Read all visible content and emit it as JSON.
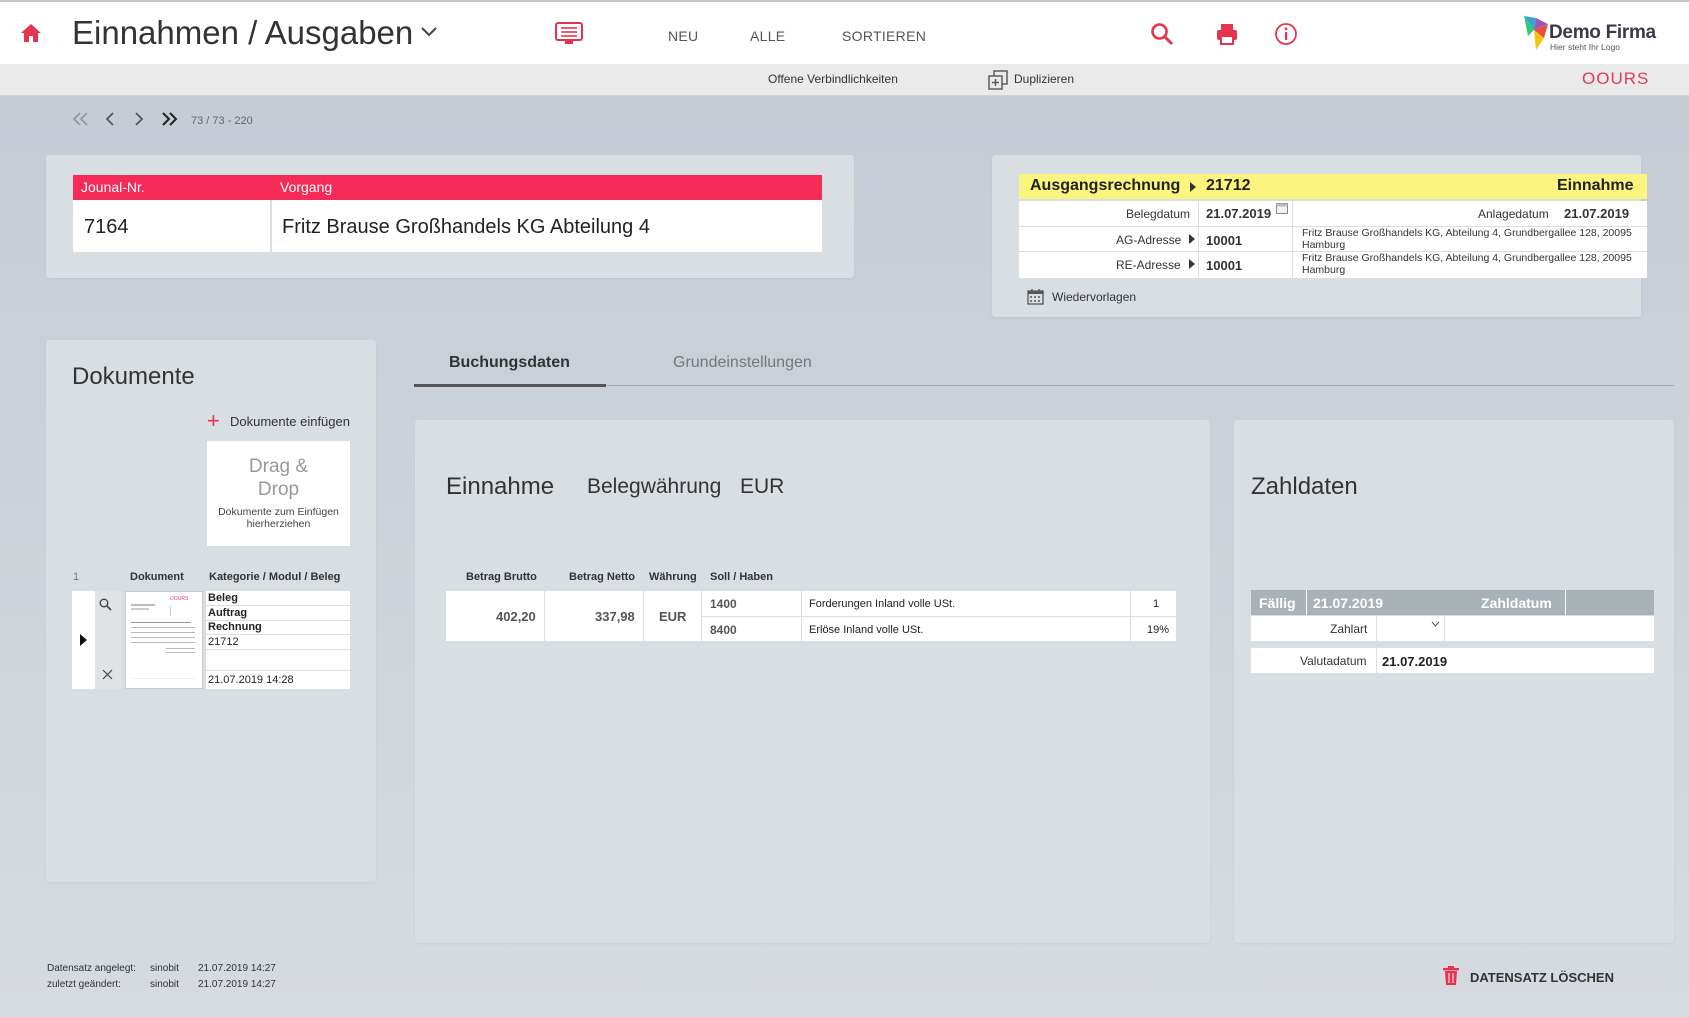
{
  "header": {
    "title": "Einnahmen / Ausgaben",
    "nav": [
      "NEU",
      "ALLE",
      "SORTIEREN"
    ],
    "logo_title": "Demo Firma",
    "logo_sub": "Hier steht Ihr Logo"
  },
  "subbar": {
    "open_liabilities": "Offene Verbindlichkeiten",
    "duplicate": "Duplizieren",
    "brand": "OOURS"
  },
  "pager": {
    "text": "73 / 73 - 220"
  },
  "journal": {
    "col1_label": "Jounal-Nr.",
    "col2_label": "Vorgang",
    "number": "7164",
    "vorgang": "Fritz Brause Großhandels KG Abteilung 4"
  },
  "doc_info": {
    "type": "Ausgangsrechnung",
    "number": "21712",
    "kind": "Einnahme",
    "belegdatum_label": "Belegdatum",
    "belegdatum": "21.07.2019",
    "anlagedatum_label": "Anlagedatum",
    "anlagedatum": "21.07.2019",
    "ag_label": "AG-Adresse",
    "ag_number": "10001",
    "ag_address": "Fritz Brause Großhandels KG, Abteilung 4, Grundbergallee 128, 20095 Hamburg",
    "re_label": "RE-Adresse",
    "re_number": "10001",
    "re_address": "Fritz Brause Großhandels KG, Abteilung 4, Grundbergallee 128, 20095 Hamburg",
    "wiedervorlagen": "Wiedervorlagen"
  },
  "documents": {
    "title": "Dokumente",
    "add_label": "Dokumente einfügen",
    "drop_title": "Drag & Drop",
    "drop_sub": "Dokumente zum Einfügen hierherziehen",
    "col_index": "1",
    "col_doc": "Dokument",
    "col_cat": "Kategorie / Modul / Beleg",
    "thumb_brand": "OOURS",
    "row": {
      "cat": "Beleg",
      "modul": "Auftrag",
      "beleg": "Rechnung",
      "number": "21712",
      "date": "21.07.2019 14:28"
    }
  },
  "tabs": {
    "active": "Buchungsdaten",
    "inactive": "Grundeinstellungen"
  },
  "booking": {
    "title": "Einnahme",
    "currency_label": "Belegwährung",
    "currency": "EUR",
    "headers": [
      "Betrag Brutto",
      "Betrag Netto",
      "Währung",
      "Soll / Haben"
    ],
    "brutto": "402,20",
    "netto": "337,98",
    "waehrung": "EUR",
    "rows": [
      {
        "account": "1400",
        "desc": "Forderungen Inland volle USt.",
        "extra": "1"
      },
      {
        "account": "8400",
        "desc": "Erlöse Inland volle USt.",
        "extra": "19%"
      }
    ]
  },
  "payment": {
    "title": "Zahldaten",
    "faellig_label": "Fällig",
    "faellig": "21.07.2019",
    "zahldatum_label": "Zahldatum",
    "zahlart_label": "Zahlart",
    "valuta_label": "Valutadatum",
    "valuta": "21.07.2019"
  },
  "footer": {
    "created_label": "Datensatz angelegt:",
    "created_user": "sinobit",
    "created_date": "21.07.2019 14:27",
    "changed_label": "zuletzt geändert:",
    "changed_user": "sinobit",
    "changed_date": "21.07.2019 14:27",
    "delete_label": "DATENSATZ LÖSCHEN"
  },
  "colors": {
    "accent": "#f52a57",
    "highlight": "#fbf47f",
    "gridhead": "#a9b2b6"
  }
}
